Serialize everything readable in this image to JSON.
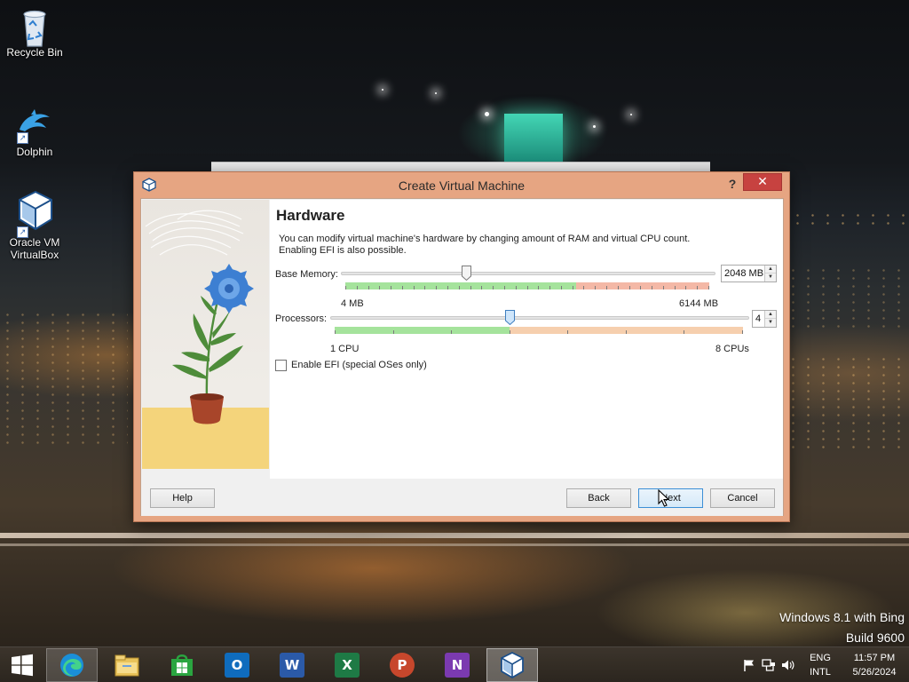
{
  "desktop": {
    "icons": [
      {
        "label": "Recycle Bin",
        "icon": "recycle-bin-icon"
      },
      {
        "label": "Dolphin",
        "icon": "dolphin-icon"
      },
      {
        "label": "Oracle VM VirtualBox",
        "icon": "virtualbox-icon"
      }
    ],
    "watermark": {
      "line1": "Windows 8.1 with Bing",
      "line2": "Build 9600"
    }
  },
  "dialog": {
    "title": "Create Virtual Machine",
    "help_glyph": "?",
    "close_glyph": "✕",
    "page_title": "Hardware",
    "description": "You can modify virtual machine's hardware by changing amount of RAM and virtual CPU count. Enabling EFI is also possible.",
    "memory": {
      "label": "Base Memory:",
      "value": 2048,
      "unit": "MB",
      "display": "2048 MB",
      "min": 4,
      "max": 6144,
      "min_label": "4 MB",
      "max_label": "6144 MB",
      "recommended_max": 3900
    },
    "processors": {
      "label": "Processors:",
      "value": 4,
      "display": "4",
      "min": 1,
      "max": 8,
      "min_label": "1 CPU",
      "max_label": "8 CPUs",
      "recommended_max": 4
    },
    "efi": {
      "label": "Enable EFI (special OSes only)",
      "checked": false
    },
    "buttons": {
      "help": "Help",
      "back": "Back",
      "next": "Next",
      "cancel": "Cancel"
    }
  },
  "taskbar": {
    "apps": [
      {
        "name": "Microsoft Edge",
        "icon": "edge-icon"
      },
      {
        "name": "File Explorer",
        "icon": "file-explorer-icon"
      },
      {
        "name": "Store",
        "icon": "store-icon"
      },
      {
        "name": "Outlook",
        "icon": "outlook-icon",
        "letter": "O",
        "color": "#0f6cbd"
      },
      {
        "name": "Word",
        "icon": "word-icon",
        "letter": "W",
        "color": "#2b5aa8"
      },
      {
        "name": "Excel",
        "icon": "excel-icon",
        "letter": "X",
        "color": "#1e7a45"
      },
      {
        "name": "PowerPoint",
        "icon": "powerpoint-icon",
        "letter": "P",
        "color": "#c7472c"
      },
      {
        "name": "OneNote",
        "icon": "onenote-icon",
        "letter": "N",
        "color": "#7b3ab0"
      },
      {
        "name": "Oracle VM VirtualBox",
        "icon": "virtualbox-icon"
      }
    ],
    "tray": {
      "lang_top": "ENG",
      "lang_bottom": "INTL",
      "time": "11:57 PM",
      "date": "5/26/2024"
    }
  },
  "colors": {
    "dialog_frame": "#e6a582",
    "close_button": "#c74240",
    "zone_ok": "#a5e39c",
    "zone_bad": "#f4b8a6",
    "default_button_border": "#3c8fd6"
  }
}
